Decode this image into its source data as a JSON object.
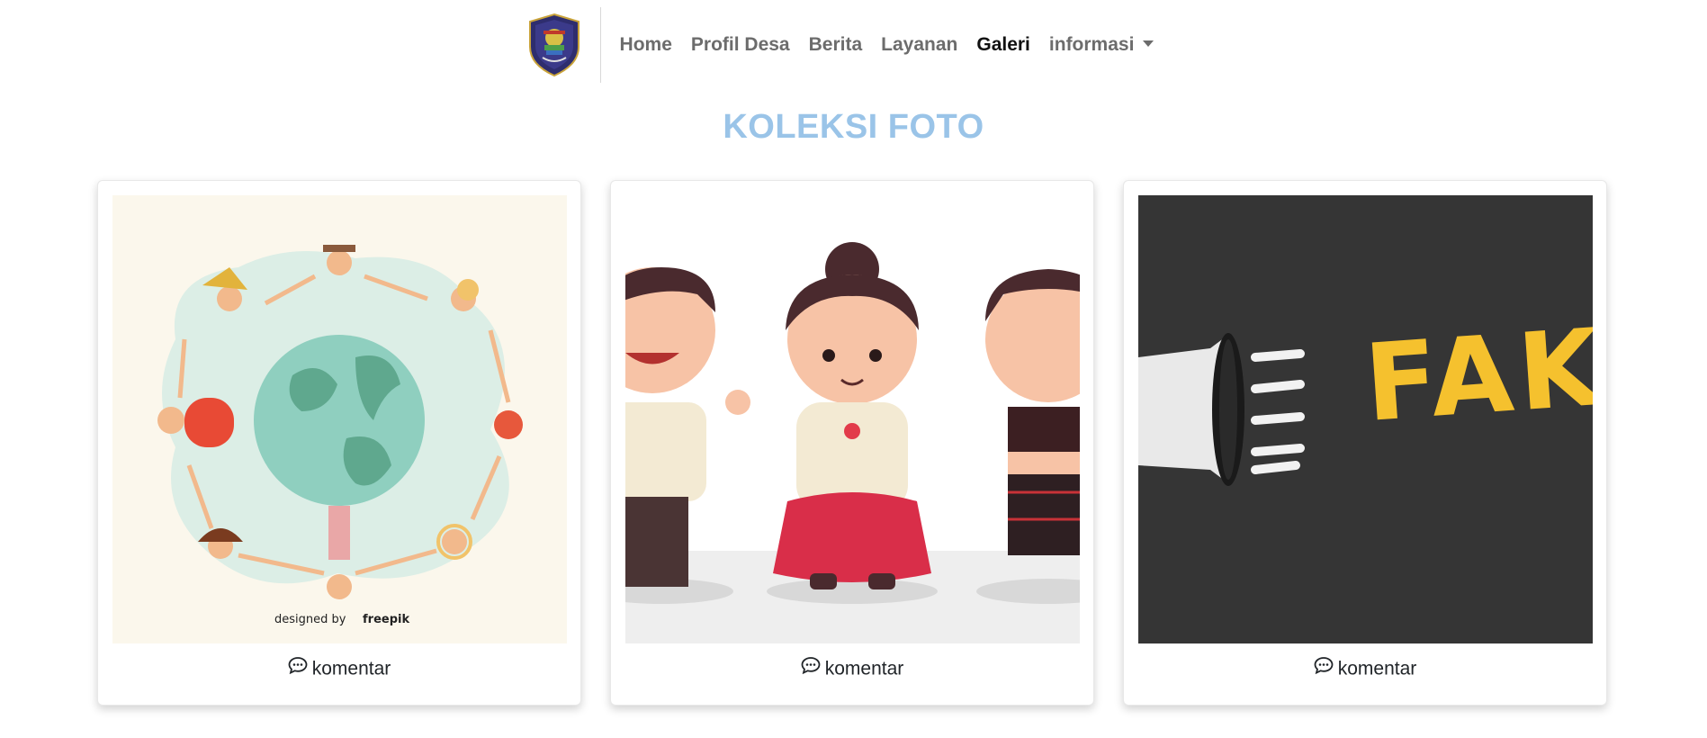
{
  "nav": {
    "logo_alt": "Logo Desa",
    "items": [
      {
        "label": "Home"
      },
      {
        "label": "Profil Desa"
      },
      {
        "label": "Berita"
      },
      {
        "label": "Layanan"
      },
      {
        "label": "Galeri",
        "active": true
      },
      {
        "label": "informasi",
        "dropdown": true
      }
    ]
  },
  "gallery": {
    "title": "KOLEKSI FOTO",
    "title_color": "#9ac4e8",
    "items": [
      {
        "image_icon": "multicultural-world-illustration",
        "image_caption": "designed by",
        "image_brand": "freepik",
        "comment_label": "komentar"
      },
      {
        "image_icon": "traditional-costume-characters",
        "comment_label": "komentar"
      },
      {
        "image_icon": "fake-news-megaphone",
        "image_text": "FAKE NEWS",
        "comment_label": "komentar"
      }
    ]
  },
  "colors": {
    "nav_link": "#6c6c6c",
    "nav_active": "#111111",
    "fake_news_yellow": "#f5c12e",
    "chalkboard": "#3a3a3a"
  }
}
